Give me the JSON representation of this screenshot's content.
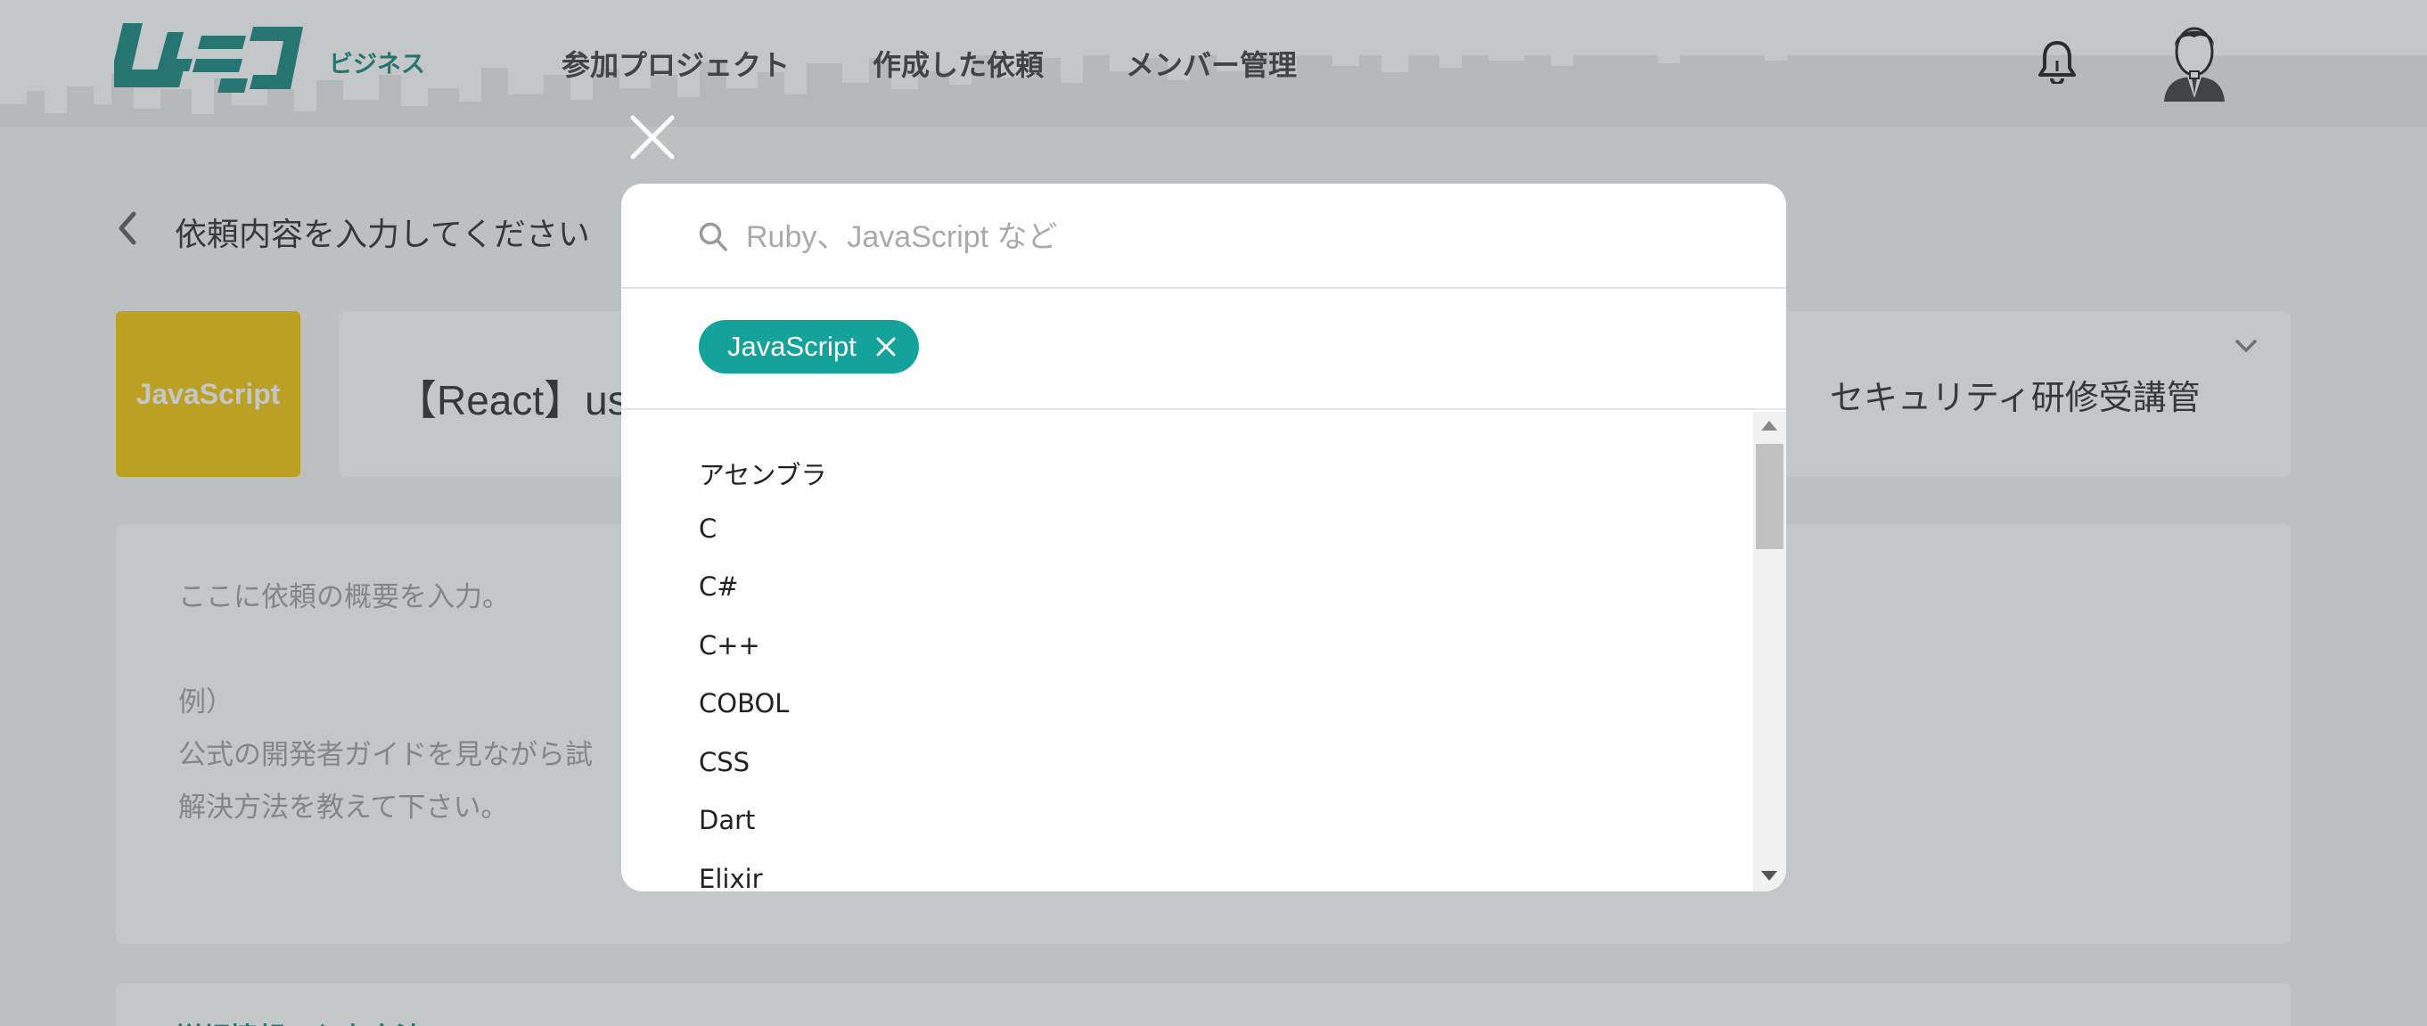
{
  "header": {
    "logo_sub": "ビジネス",
    "nav": [
      "参加プロジェクト",
      "作成した依頼",
      "メンバー管理"
    ]
  },
  "page": {
    "back_title": "依頼内容を入力してください",
    "lang_badge": "JavaScript",
    "request_title": "【React】us",
    "org_name": "セキュリティ研修受講管",
    "description_lines": [
      "ここに依頼の概要を入力。",
      "例）",
      "公式の開発者ガイドを見ながら試",
      "解決方法を教えて下さい。"
    ],
    "detail_link": "詳細情報の入力方法"
  },
  "modal": {
    "search_placeholder": "Ruby、JavaScript など",
    "selected_tags": [
      "JavaScript"
    ],
    "options": [
      "アセンブラ",
      "C",
      "C#",
      "C++",
      "COBOL",
      "CSS",
      "Dart",
      "Elixir"
    ]
  },
  "colors": {
    "brand": "#0a7f7a",
    "chip": "#14a39a",
    "badge": "#f3c300"
  }
}
